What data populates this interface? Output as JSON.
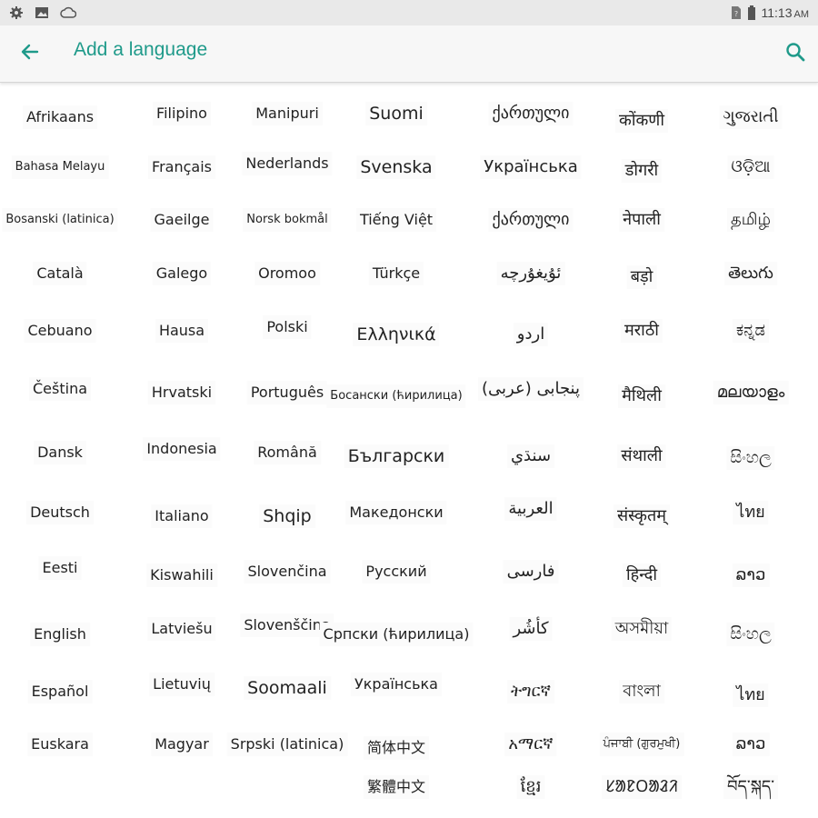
{
  "status_bar": {
    "time": "11:13",
    "ampm": "AM",
    "icons": [
      "gear-icon",
      "image-icon",
      "cloud-icon",
      "sim-icon",
      "battery-icon"
    ]
  },
  "app_bar": {
    "title": "Add a language",
    "back_icon": "arrow-back-icon",
    "search_icon": "search-icon",
    "accent_color": "#1f9a8a"
  },
  "languages": [
    [
      "Afrikaans",
      "Filipino",
      "Manipuri",
      "Suomi",
      "ქართული",
      "कोंकणी",
      "ગુજરાતી"
    ],
    [
      "Bahasa Melayu",
      "Français",
      "Nederlands",
      "Svenska",
      "Українська",
      "डोगरी",
      "ଓଡ଼ିଆ"
    ],
    [
      "Bosanski (latinica)",
      "Gaeilge",
      "Norsk bokmål",
      "Tiếng Việt",
      "ქართული",
      "नेपाली",
      "தமிழ்"
    ],
    [
      "Català",
      "Galego",
      "Oromoo",
      "Türkçe",
      "ئۇيغۇرچە",
      "बड़ो",
      "తెలుగు"
    ],
    [
      "Cebuano",
      "Hausa",
      "Polski",
      "Ελληνικά",
      "اردو",
      "मराठी",
      "ಕನ್ನಡ"
    ],
    [
      "Čeština",
      "Hrvatski",
      "Português",
      "Босански (ћирилица)",
      "پنجابی (عربی)",
      "मैथिली",
      "മലയാളം"
    ],
    [
      "Dansk",
      "Indonesia",
      "Română",
      "Български",
      "سنڌي",
      "संथाली",
      "සිංහල"
    ],
    [
      "Deutsch",
      "Italiano",
      "Shqip",
      "Македонски",
      "العربية",
      "संस्कृतम्",
      "ไทย"
    ],
    [
      "Eesti",
      "Kiswahili",
      "Slovenčina",
      "Русский",
      "فارسی",
      "हिन्दी",
      "ລາວ"
    ],
    [
      "English",
      "Latviešu",
      "Slovenščina",
      "Српски (ћирилица)",
      "كأشُر",
      "অসমীয়া",
      "සිංහල"
    ],
    [
      "Español",
      "Lietuvių",
      "Soomaali",
      "Українська",
      "ትግርኛ",
      "বাংলা",
      "ไทย"
    ],
    [
      "Euskara",
      "Magyar",
      "Srpski (latinica)",
      "简体中文",
      "አማርኛ",
      "ਪੰਜਾਬੀ (ਗੁਰਮੁਖੀ)",
      "ລາວ"
    ],
    [
      "",
      "",
      "",
      "繁體中文",
      "ខ្មែរ",
      "ᱥᱟᱱᱛᱟᱲᱤ",
      "བོད་སྐད་"
    ]
  ]
}
